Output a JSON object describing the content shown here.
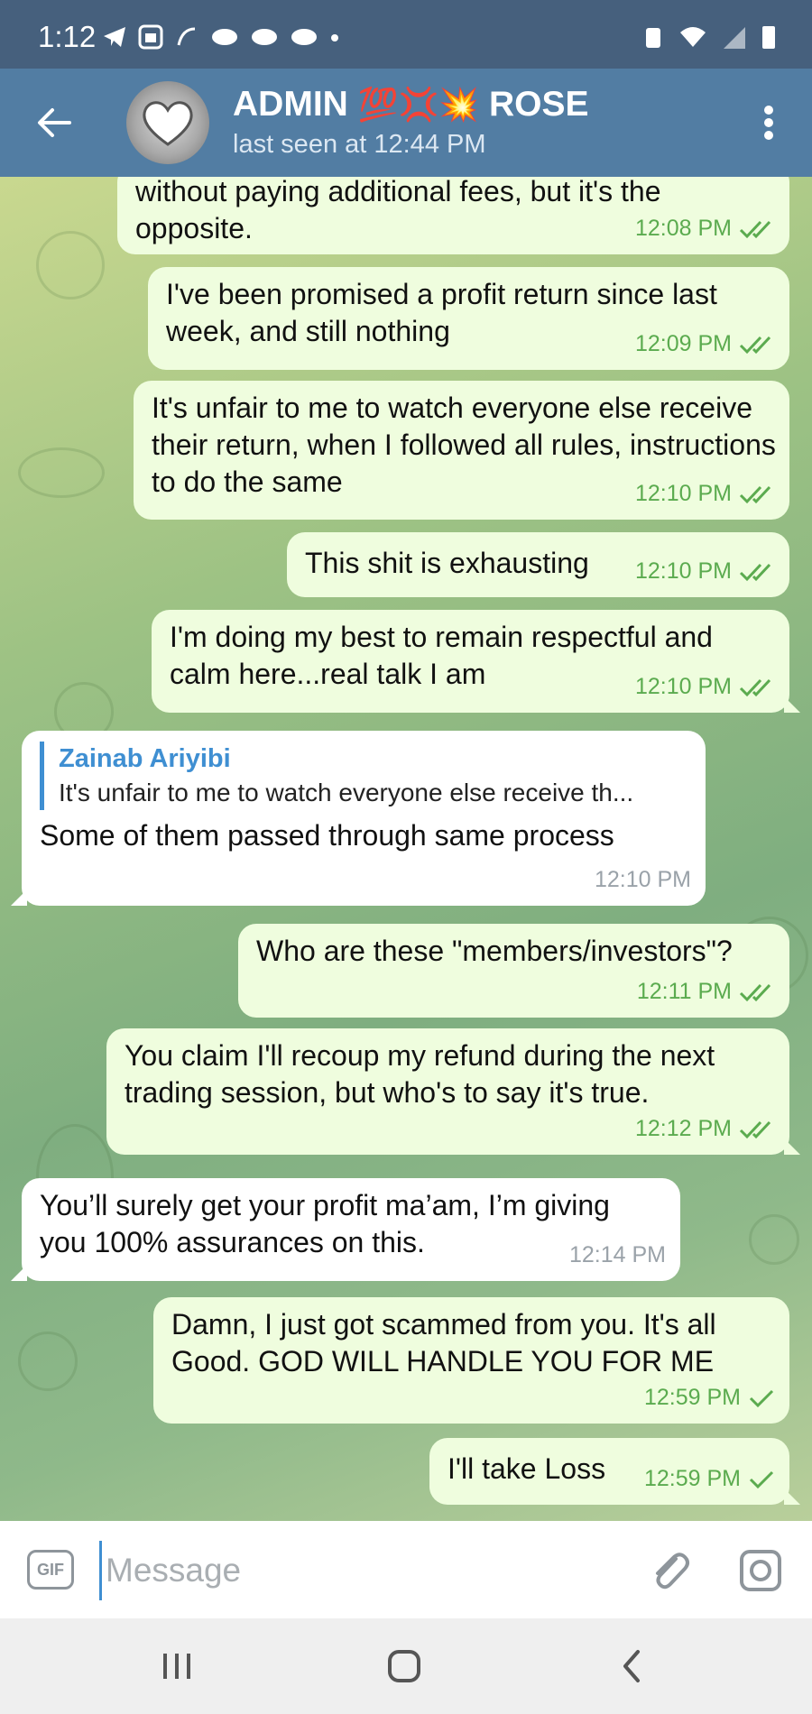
{
  "status_bar": {
    "time": "1:12"
  },
  "header": {
    "title": "ADMIN",
    "title_emoji": "💯💢💥",
    "title_suffix": "ROSE",
    "status": "last seen at 12:44 PM"
  },
  "messages": [
    {
      "direction": "out",
      "text_line1": "without paying additional fees, but it's the",
      "text_line2": "opposite.",
      "time": "12:08 PM",
      "ticks": "double"
    },
    {
      "direction": "out",
      "text": "I've been promised a profit return since last week, and still nothing",
      "time": "12:09 PM",
      "ticks": "double"
    },
    {
      "direction": "out",
      "text": "It's unfair to me to watch everyone else receive their return, when I followed all rules, instructions to do the same",
      "time": "12:10 PM",
      "ticks": "double"
    },
    {
      "direction": "out",
      "text": "This shit is exhausting",
      "time": "12:10 PM",
      "ticks": "double"
    },
    {
      "direction": "out",
      "text": "I'm doing my best to remain respectful and calm here...real talk I am",
      "time": "12:10 PM",
      "ticks": "double"
    },
    {
      "direction": "in",
      "reply_name": "Zainab Ariyibi",
      "reply_text": "It's unfair to me to watch everyone else receive th...",
      "text": "Some of them passed through same process",
      "time": "12:10 PM"
    },
    {
      "direction": "out",
      "text": "Who are these \"members/investors\"?",
      "time": "12:11 PM",
      "ticks": "double"
    },
    {
      "direction": "out",
      "text": "You claim I'll recoup my refund during the next trading session, but who's to say it's true.",
      "time": "12:12 PM",
      "ticks": "double"
    },
    {
      "direction": "in",
      "text": "You’ll surely get your profit ma’am, I’m giving you 100% assurances on this.",
      "time": "12:14 PM"
    },
    {
      "direction": "out",
      "text": "Damn, I just got scammed from you. It's all Good. GOD WILL HANDLE YOU FOR ME",
      "time": "12:59 PM",
      "ticks": "single"
    },
    {
      "direction": "out",
      "text": "I'll take Loss",
      "time": "12:59 PM",
      "ticks": "single"
    }
  ],
  "input": {
    "placeholder": "Message",
    "gif_label": "GIF"
  },
  "colors": {
    "header": "#527da3",
    "status_bar": "#46607d",
    "outgoing_bubble": "#effdde",
    "incoming_bubble": "#ffffff",
    "tick": "#5bab4f",
    "accent": "#3f8fd2"
  },
  "icons": [
    "back-arrow-icon",
    "more-vert-icon",
    "double-check-icon",
    "single-check-icon",
    "gif-icon",
    "paperclip-icon",
    "camera-icon",
    "recents-icon",
    "home-icon",
    "nav-back-icon"
  ]
}
